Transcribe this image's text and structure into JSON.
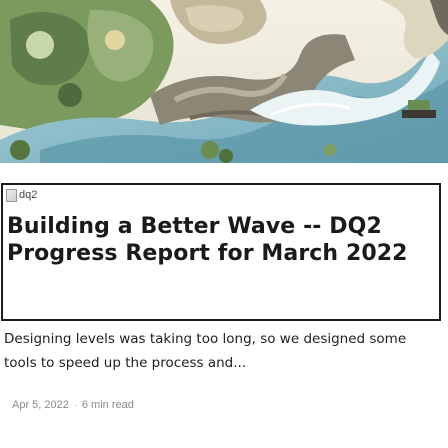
{
  "hero": {
    "icon": "hero-illustration"
  },
  "title_block": {
    "image_alt": "dq2",
    "title": "Building a Better Wave -- DQ2 Progress Report for March 2022"
  },
  "excerpt": "Designing levels was taking too long, so we designed some tools to speed up the process and...",
  "meta": {
    "date": "Apr 5, 2022",
    "separator": "·",
    "read_time": "6 min read"
  }
}
